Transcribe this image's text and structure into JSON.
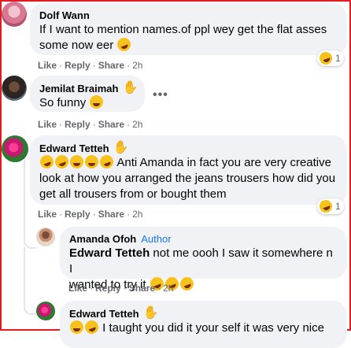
{
  "comments": [
    {
      "name": "Dolf Wann",
      "text_line1": "If I want to mention names.of ppl wey get the flat asses",
      "text_line2": "some now eer",
      "actions": {
        "like": "Like",
        "reply": "Reply",
        "share": "Share",
        "time": "2h"
      },
      "reaction_count": "1"
    },
    {
      "name": "Jemilat Braimah",
      "text": "So funny",
      "actions": {
        "like": "Like",
        "reply": "Reply",
        "share": "Share",
        "time": "2h"
      },
      "more": "•••"
    },
    {
      "name": "Edward Tetteh",
      "text_line1": "Anti Amanda in fact you are very creative",
      "text_line2": "look at how you arranged the jeans trousers how did you",
      "text_line3": "get all trousers from or bought them",
      "actions": {
        "like": "Like",
        "reply": "Reply",
        "share": "Share",
        "time": "2h"
      },
      "reaction_count": "1"
    }
  ],
  "replies": [
    {
      "name": "Amanda Ofoh",
      "badge": "Author",
      "mention": "Edward Tetteh",
      "text_line1": "not me oooh I saw it somewhere n I",
      "text_line2": "wanted to try it",
      "actions": {
        "like": "Like",
        "reply": "Reply",
        "share": "Share",
        "time": "2h"
      }
    },
    {
      "name": "Edward Tetteh",
      "text": "I taught you did it your self it was very nice"
    }
  ],
  "separators": {
    "dot": "·"
  },
  "icons": {
    "wave": "waving-hand-icon",
    "emoji": "rofl-emoji-icon"
  },
  "colors": {
    "bubble": "#f0f2f5",
    "link": "#1877f2",
    "muted": "#65676b",
    "frame": "#e41b23"
  }
}
